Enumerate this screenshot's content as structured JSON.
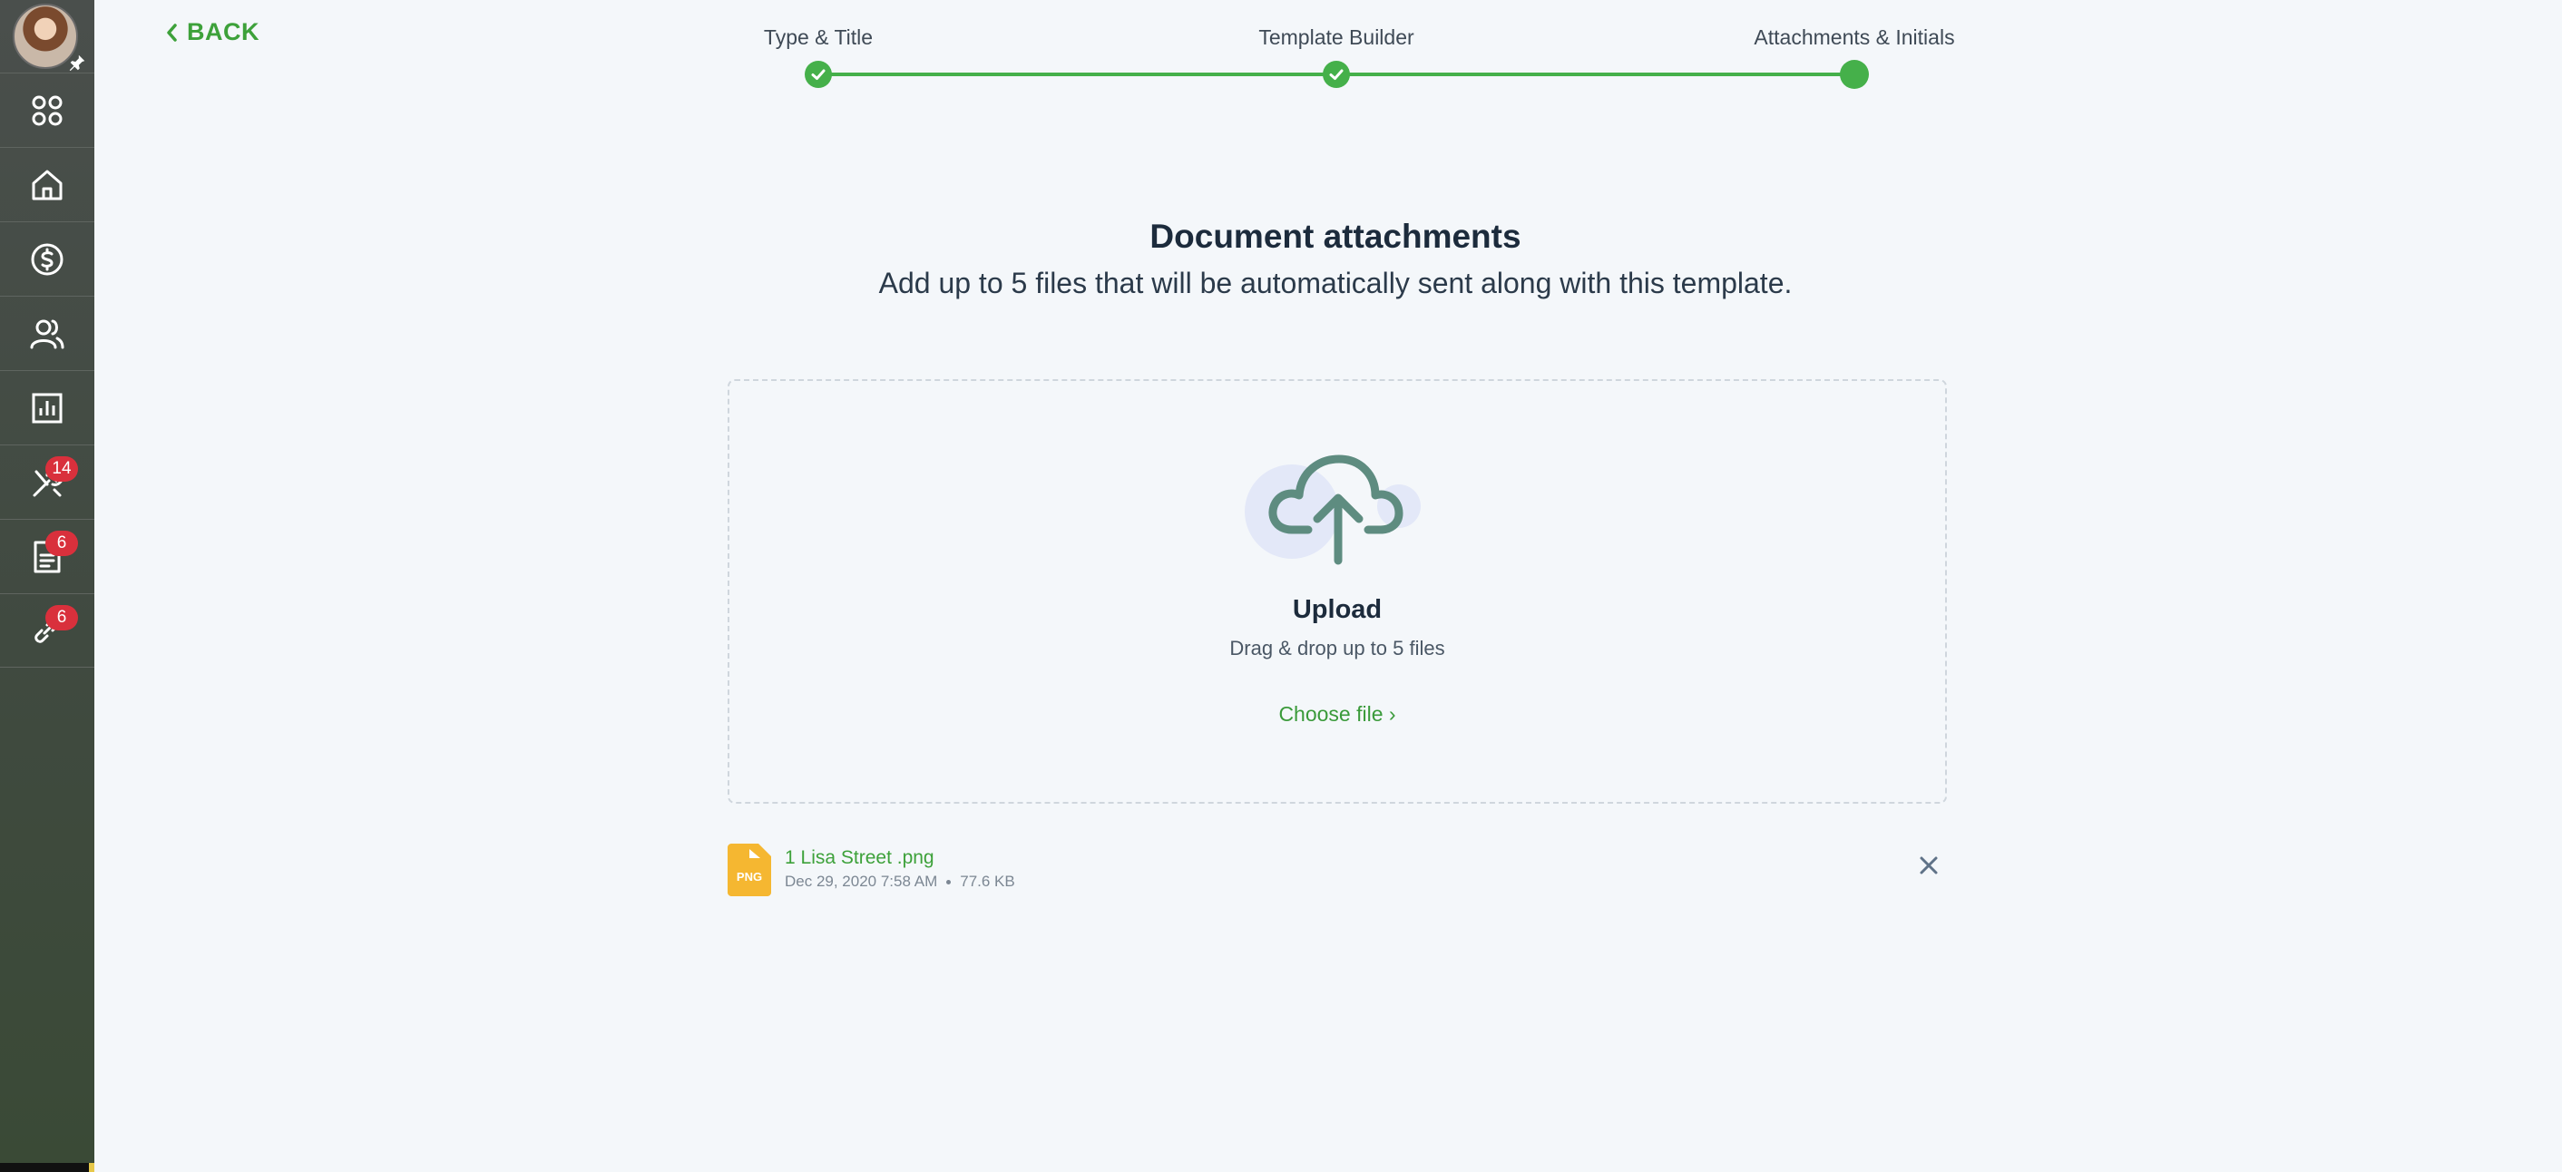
{
  "sidebar": {
    "items": [
      {
        "icon": "apps-grid-icon",
        "badge": ""
      },
      {
        "icon": "home-icon",
        "badge": ""
      },
      {
        "icon": "dollar-icon",
        "badge": ""
      },
      {
        "icon": "users-icon",
        "badge": ""
      },
      {
        "icon": "reports-icon",
        "badge": ""
      },
      {
        "icon": "tools-icon",
        "badge": "14"
      },
      {
        "icon": "document-icon",
        "badge": "6"
      },
      {
        "icon": "link-icon",
        "badge": "6"
      }
    ]
  },
  "header": {
    "back_label": "BACK",
    "steps": [
      {
        "label": "Type & Title",
        "status": "complete"
      },
      {
        "label": "Template Builder",
        "status": "complete"
      },
      {
        "label": "Attachments & Initials",
        "status": "current"
      }
    ]
  },
  "main": {
    "title": "Document attachments",
    "subtitle": "Add up to 5 files that will be automatically sent along with this template."
  },
  "upload": {
    "title": "Upload",
    "hint": "Drag & drop up to 5 files",
    "choose_label": "Choose file ›"
  },
  "attachments": [
    {
      "type": "PNG",
      "name": "1 Lisa Street .png",
      "date": "Dec 29, 2020 7:58 AM",
      "size": "77.6 KB"
    }
  ],
  "colors": {
    "accent_green": "#45b04a",
    "badge_red": "#d9303c",
    "file_png": "#f5b731"
  }
}
